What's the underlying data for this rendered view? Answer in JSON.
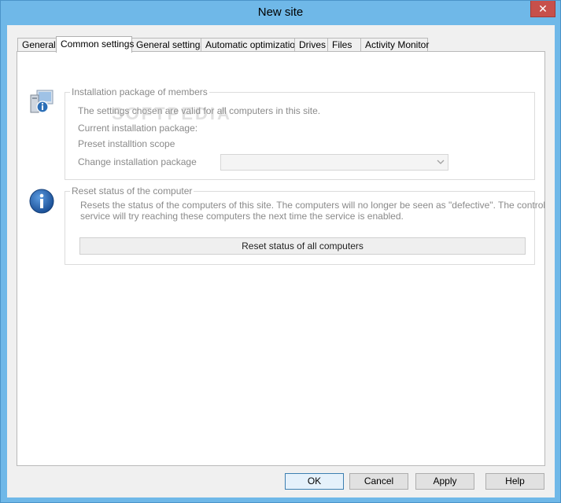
{
  "window": {
    "title": "New site",
    "close_glyph": "✕"
  },
  "tabs": [
    {
      "label": "General"
    },
    {
      "label": "Common settings"
    },
    {
      "label": "General settings"
    },
    {
      "label": "Automatic optimization"
    },
    {
      "label": "Drives"
    },
    {
      "label": "Files"
    },
    {
      "label": "Activity Monitor"
    }
  ],
  "active_tab": "Common settings",
  "install_group": {
    "title": "Installation package of members",
    "description": "The settings chosen are valid for all computers in this site.",
    "current_label": "Current installation package:",
    "preset_label": "Preset installtion scope",
    "change_label": "Change installation package",
    "change_value": "",
    "icon": "computer-info-icon"
  },
  "reset_group": {
    "title": "Reset status of the computer",
    "description_line1": "Resets the status of the computers of this site. The computers will no longer be seen as \"defective\". The control",
    "description_line2": "service will try reaching these computers the next time the service is enabled.",
    "button_label": "Reset status of all computers",
    "icon": "info-icon"
  },
  "watermark": "SOFTPEDIA",
  "buttons": {
    "ok": "OK",
    "cancel": "Cancel",
    "apply": "Apply",
    "help": "Help"
  },
  "colors": {
    "titlebar": "#6fb8e8",
    "close": "#c7504b",
    "default_button_border": "#3c7fb1"
  }
}
